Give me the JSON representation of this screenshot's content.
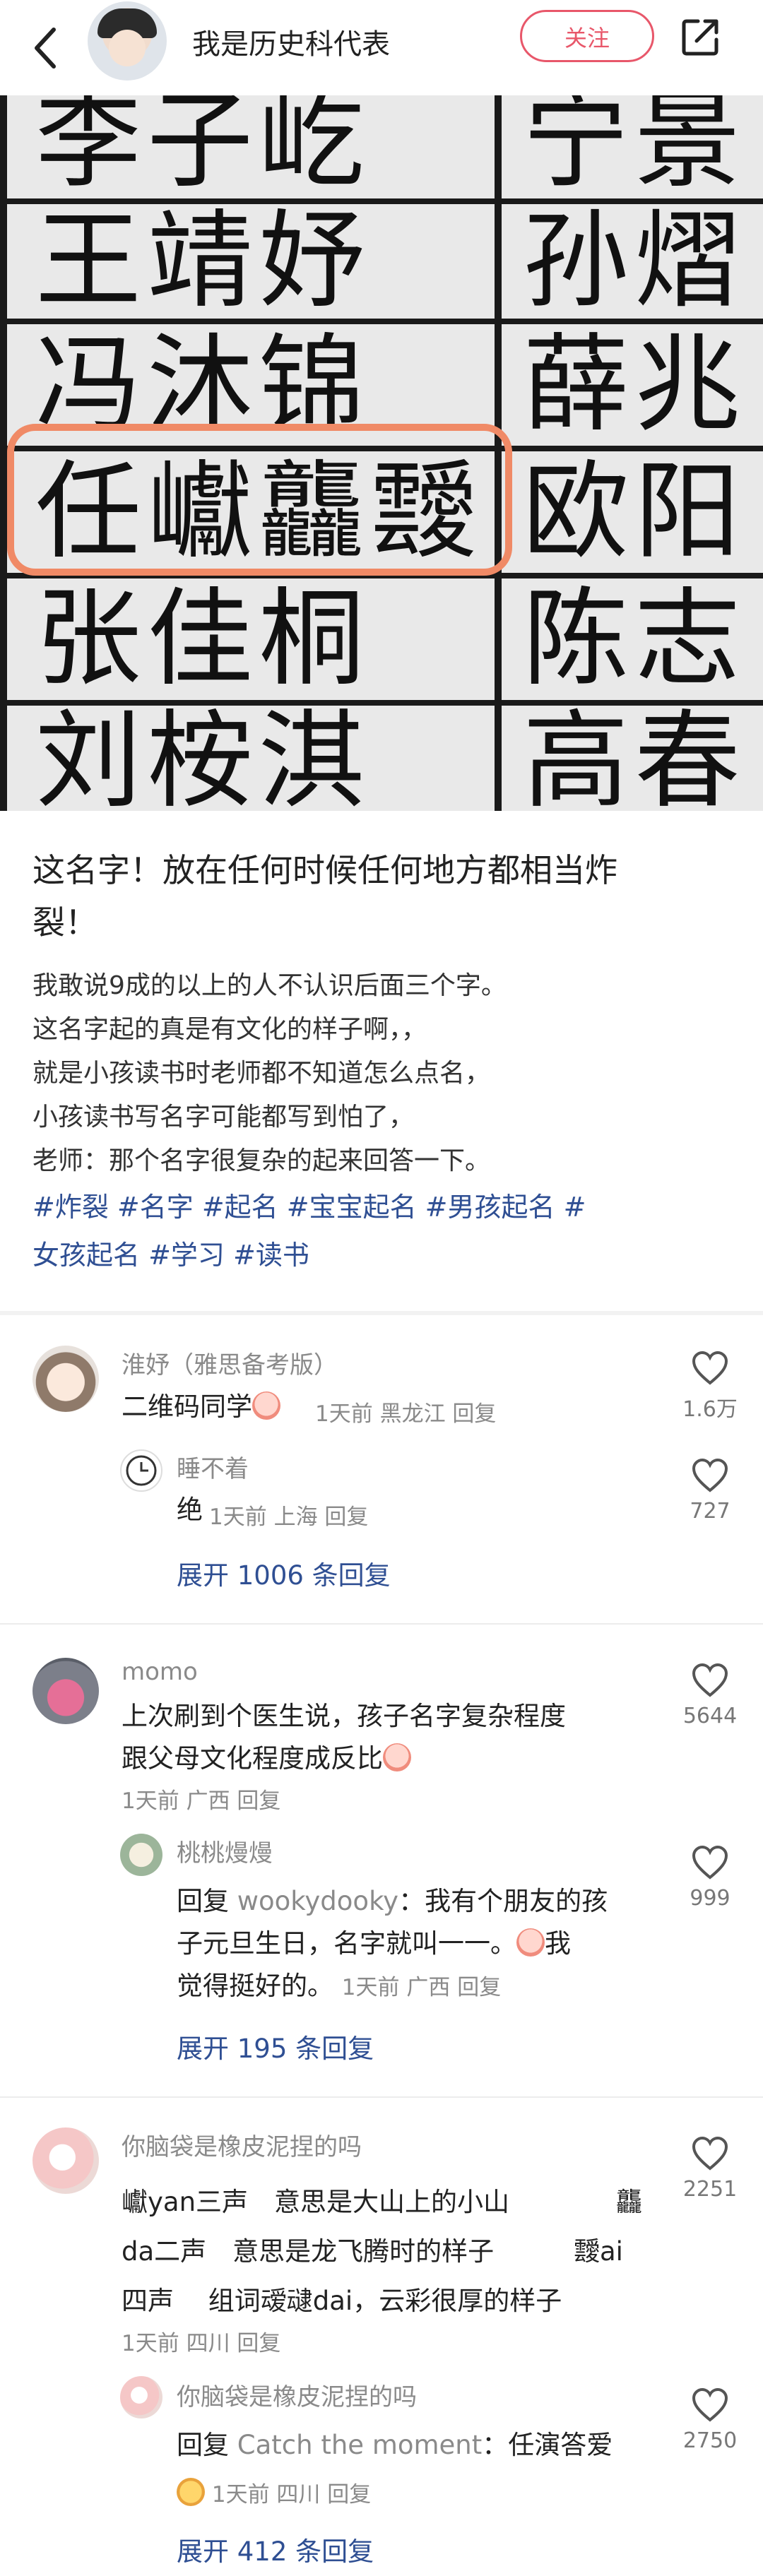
{
  "header": {
    "author_name": "我是历史科代表",
    "follow_label": "关注"
  },
  "photo": {
    "row1_left": "李子屹",
    "row1_right": "宁景",
    "row2_left": "王靖妤",
    "row2_right": "孙熠",
    "row3_left": "冯沐锦",
    "row3_right": "薛兆",
    "row4_left": "任巘龘靉",
    "row4_right": "欧阳",
    "row5_left": "张佳桐",
    "row5_right": "陈志",
    "row6_left": "刘桉淇",
    "row6_right": "高春"
  },
  "post": {
    "title_line1": "这名字！放在任何时候任何地方都相当炸",
    "title_line2": "裂！",
    "body": [
      "我敢说9成的以上的人不认识后面三个字。",
      "这名字起的真是有文化的样子啊，，",
      "就是小孩读书时老师都不知道怎么点名，",
      "小孩读书写名字可能都写到怕了，",
      "老师：那个名字很复杂的起来回答一下。"
    ],
    "tags_line1": "#炸裂 #名字 #起名 #宝宝起名 #男孩起名 #",
    "tags_line2": "女孩起名 #学习 #读书"
  },
  "comments": [
    {
      "name": "淮妤（雅思备考版）",
      "text": "二维码同学",
      "meta": "1天前 黑龙江 回复",
      "likes": "1.6万",
      "reply": {
        "name": "睡不着",
        "text": "绝",
        "meta": "1天前 上海 回复",
        "likes": "727"
      },
      "expand": "展开 1006 条回复"
    },
    {
      "name": "momo",
      "text_line1": "上次刷到个医生说，孩子名字复杂程度",
      "text_line2": "跟父母文化程度成反比",
      "meta": "1天前 广西 回复",
      "likes": "5644",
      "reply": {
        "name": "桃桃熳熳",
        "reply_prefix": "回复",
        "reply_to": "wookydooky",
        "text_line1": "：我有个朋友的孩",
        "text_line2": "子元旦生日，名字就叫一一。",
        "text_line2_tail": "我",
        "text_line3": "觉得挺好的。",
        "meta": "1天前 广西 回复",
        "likes": "999"
      },
      "expand": "展开 195 条回复"
    },
    {
      "name": "你脑袋是橡皮泥捏的吗",
      "line1a": "巘yan三声　意思是大山上的小山",
      "line1b": "龘",
      "line2a": "da二声　意思是龙飞腾时的样子",
      "line2b": "靉ai",
      "line3": "四声　 组词叆叇dai，云彩很厚的样子",
      "meta": "1天前 四川 回复",
      "likes": "2251",
      "reply": {
        "name": "你脑袋是橡皮泥捏的吗",
        "reply_prefix": "回复",
        "reply_to": "Catch the moment",
        "text": "：任演答爱",
        "meta": "1天前 四川 回复",
        "likes": "2750"
      },
      "expand": "展开 412 条回复"
    }
  ]
}
